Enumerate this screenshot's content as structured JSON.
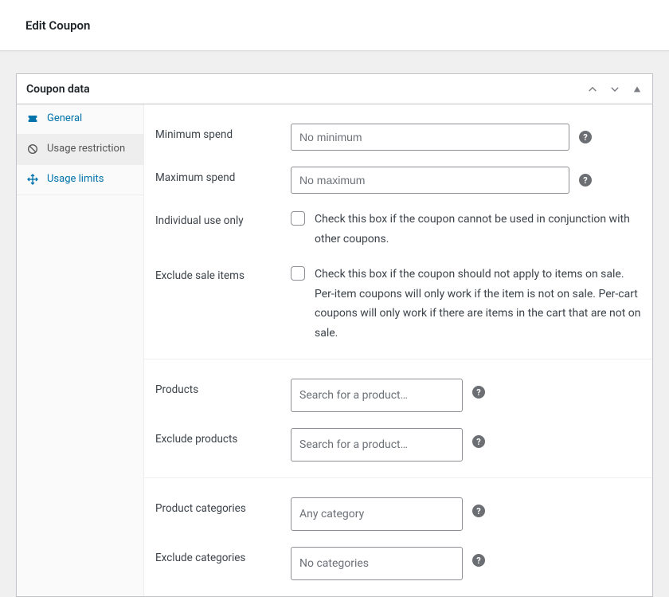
{
  "page": {
    "title": "Edit Coupon"
  },
  "metabox": {
    "title": "Coupon data"
  },
  "tabs": {
    "general": {
      "label": "General"
    },
    "usage_restriction": {
      "label": "Usage restriction"
    },
    "usage_limits": {
      "label": "Usage limits"
    }
  },
  "fields": {
    "min_spend": {
      "label": "Minimum spend",
      "placeholder": "No minimum"
    },
    "max_spend": {
      "label": "Maximum spend",
      "placeholder": "No maximum"
    },
    "individual": {
      "label": "Individual use only",
      "description": "Check this box if the coupon cannot be used in conjunction with other coupons."
    },
    "exclude_sale": {
      "label": "Exclude sale items",
      "description": "Check this box if the coupon should not apply to items on sale. Per-item coupons will only work if the item is not on sale. Per-cart coupons will only work if there are items in the cart that are not on sale."
    },
    "products": {
      "label": "Products",
      "placeholder": "Search for a product…"
    },
    "exclude_products": {
      "label": "Exclude products",
      "placeholder": "Search for a product…"
    },
    "categories": {
      "label": "Product categories",
      "placeholder": "Any category"
    },
    "exclude_categories": {
      "label": "Exclude categories",
      "placeholder": "No categories"
    }
  },
  "help_glyph": "?"
}
